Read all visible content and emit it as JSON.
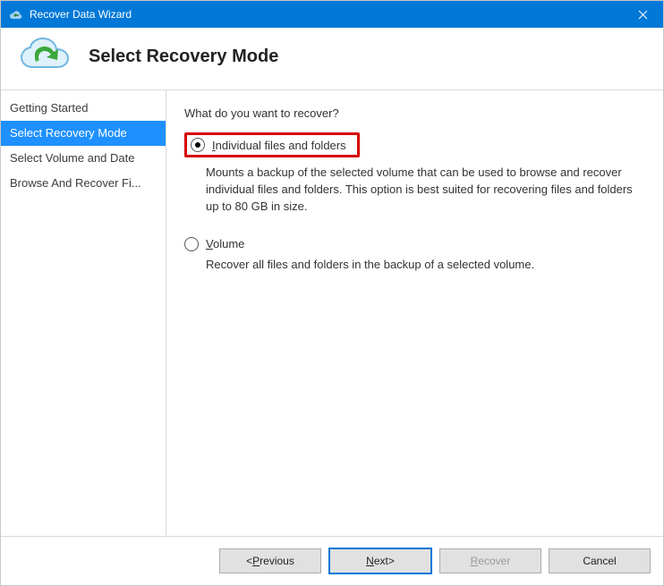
{
  "titlebar": {
    "title": "Recover Data Wizard"
  },
  "header": {
    "page_title": "Select Recovery Mode"
  },
  "sidebar": {
    "items": [
      {
        "label": "Getting Started",
        "selected": false
      },
      {
        "label": "Select Recovery Mode",
        "selected": true
      },
      {
        "label": "Select Volume and Date",
        "selected": false
      },
      {
        "label": "Browse And Recover Fi...",
        "selected": false
      }
    ]
  },
  "content": {
    "prompt": "What do you want to recover?",
    "options": [
      {
        "accel": "I",
        "label_rest": "ndividual files and folders",
        "selected": true,
        "highlighted": true,
        "description": "Mounts a backup of the selected volume that can be used to browse and recover individual files and folders. This option is best suited for recovering files and folders up to 80 GB in size."
      },
      {
        "accel": "V",
        "label_rest": "olume",
        "selected": false,
        "highlighted": false,
        "description": "Recover all files and folders in the backup of a selected volume."
      }
    ]
  },
  "footer": {
    "previous": {
      "prefix": "< ",
      "accel": "P",
      "rest": "revious"
    },
    "next": {
      "accel": "N",
      "rest": "ext",
      "suffix": " >"
    },
    "recover": {
      "accel": "R",
      "rest": "ecover"
    },
    "cancel": {
      "label": "Cancel"
    }
  }
}
